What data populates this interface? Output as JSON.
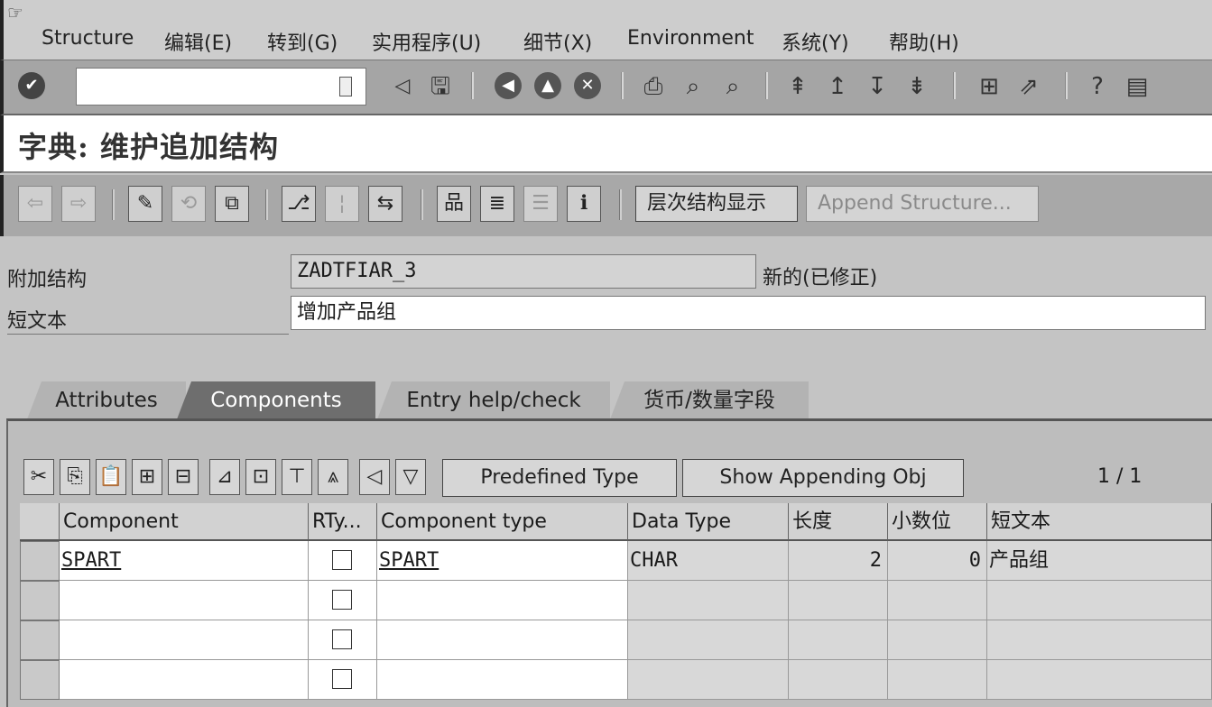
{
  "menu": {
    "corner_icon": "menu-corner-icon",
    "items": [
      "Structure",
      "编辑(E)",
      "转到(G)",
      "实用程序(U)",
      "细节(X)",
      "Environment",
      "系统(Y)",
      "帮助(H)"
    ]
  },
  "toolbar": {
    "command_field_value": ""
  },
  "title": "字典: 维护追加结构",
  "app_toolbar": {
    "hierarchy_button": "层次结构显示",
    "append_structure_button": "Append Structure..."
  },
  "header": {
    "append_structure_label": "附加结构",
    "append_structure_value": "ZADTFIAR_3",
    "status": "新的(已修正)",
    "short_text_label": "短文本",
    "short_text_value": "增加产品组"
  },
  "tabs": [
    "Attributes",
    "Components",
    "Entry help/check",
    "货币/数量字段"
  ],
  "active_tab": "Components",
  "grid_toolbar": {
    "predefined_type_button": "Predefined Type",
    "show_appending_button": "Show Appending Obj",
    "pager": "1 / 1"
  },
  "table": {
    "columns": [
      "Component",
      "RTy...",
      "Component type",
      "Data Type",
      "长度",
      "小数位",
      "短文本"
    ],
    "rows": [
      {
        "component": "SPART",
        "rtype_checked": false,
        "component_type": "SPART",
        "data_type": "CHAR",
        "length": "2",
        "decimals": "0",
        "short_text": "产品组"
      },
      {
        "component": "",
        "rtype_checked": false,
        "component_type": "",
        "data_type": "",
        "length": "",
        "decimals": "",
        "short_text": ""
      },
      {
        "component": "",
        "rtype_checked": false,
        "component_type": "",
        "data_type": "",
        "length": "",
        "decimals": "",
        "short_text": ""
      },
      {
        "component": "",
        "rtype_checked": false,
        "component_type": "",
        "data_type": "",
        "length": "",
        "decimals": "",
        "short_text": ""
      }
    ]
  },
  "colors": {
    "window_bg": "#c4c4c4",
    "toolbar_bg": "#a5a5a5",
    "active_tab": "#6e6e6e",
    "field_bg": "#d8d8d8"
  }
}
